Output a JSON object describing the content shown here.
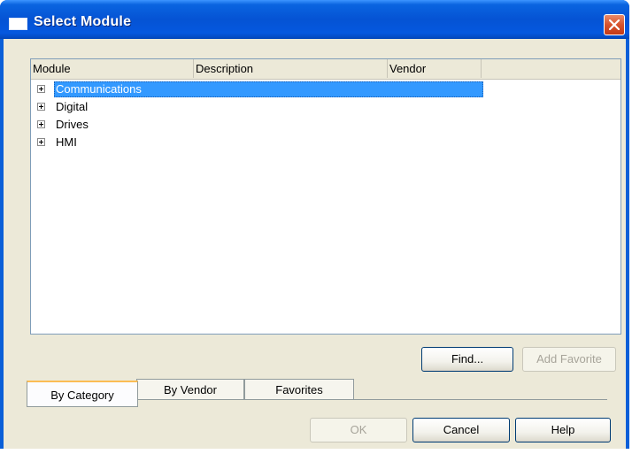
{
  "window": {
    "title": "Select Module",
    "close_icon": "close-icon"
  },
  "list": {
    "columns": [
      "Module",
      "Description",
      "Vendor"
    ],
    "rows": [
      {
        "label": "Communications",
        "selected": true
      },
      {
        "label": "Digital",
        "selected": false
      },
      {
        "label": "Drives",
        "selected": false
      },
      {
        "label": "HMI",
        "selected": false
      }
    ]
  },
  "buttons": {
    "find": "Find...",
    "add_favorite": "Add Favorite",
    "ok": "OK",
    "cancel": "Cancel",
    "help": "Help"
  },
  "tabs": [
    {
      "label": "By Category",
      "active": true
    },
    {
      "label": "By Vendor",
      "active": false
    },
    {
      "label": "Favorites",
      "active": false
    }
  ],
  "colors": {
    "title_bar": "#0553d4",
    "selection": "#3399ff",
    "dialog_face": "#ece9d8"
  }
}
